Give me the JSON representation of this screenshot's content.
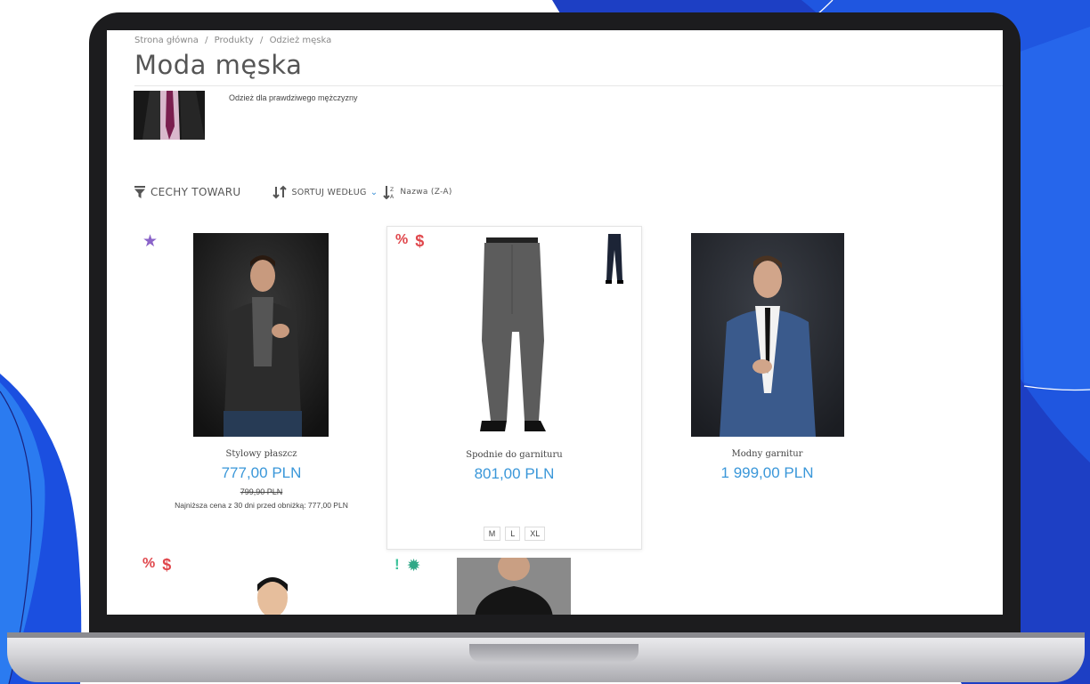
{
  "breadcrumb": [
    "Strona główna",
    "/",
    "Produkty",
    "/",
    "Odzież męska"
  ],
  "page_title": "Moda męska",
  "category_description": "Odzież dla prawdziwego mężczyzny",
  "toolbar": {
    "filter_label": "CECHY TOWARU",
    "sort_label": "SORTUJ WEDŁUG",
    "sort_value": "Nazwa (Z-A)"
  },
  "products": [
    {
      "name": "Stylowy płaszcz",
      "price": "777,00 PLN",
      "old_price": "799,90 PLN",
      "lowest_price_note": "Najniższa cena z 30 dni przed obniżką: 777,00 PLN",
      "badges": [
        "star-icon"
      ]
    },
    {
      "name": "Spodnie do garnituru",
      "price": "801,00 PLN",
      "sizes": [
        "M",
        "L",
        "XL"
      ],
      "badges": [
        "percent-icon",
        "dollar-icon"
      ]
    },
    {
      "name": "Modny garnitur",
      "price": "1 999,00 PLN",
      "badges": []
    },
    {
      "badges": [
        "percent-icon",
        "dollar-icon"
      ]
    },
    {
      "badges": [
        "exclamation-icon",
        "gear-badge-icon"
      ]
    }
  ],
  "badge_glyphs": {
    "percent": "%",
    "dollar": "$",
    "star": "★",
    "exclamation": "!",
    "gear": "✹"
  },
  "colors": {
    "accent": "#3a97d9",
    "badge_red": "#e0474c",
    "badge_purple": "#8a63c9",
    "badge_green": "#30a887",
    "background_blue": "#1f4fd6"
  }
}
